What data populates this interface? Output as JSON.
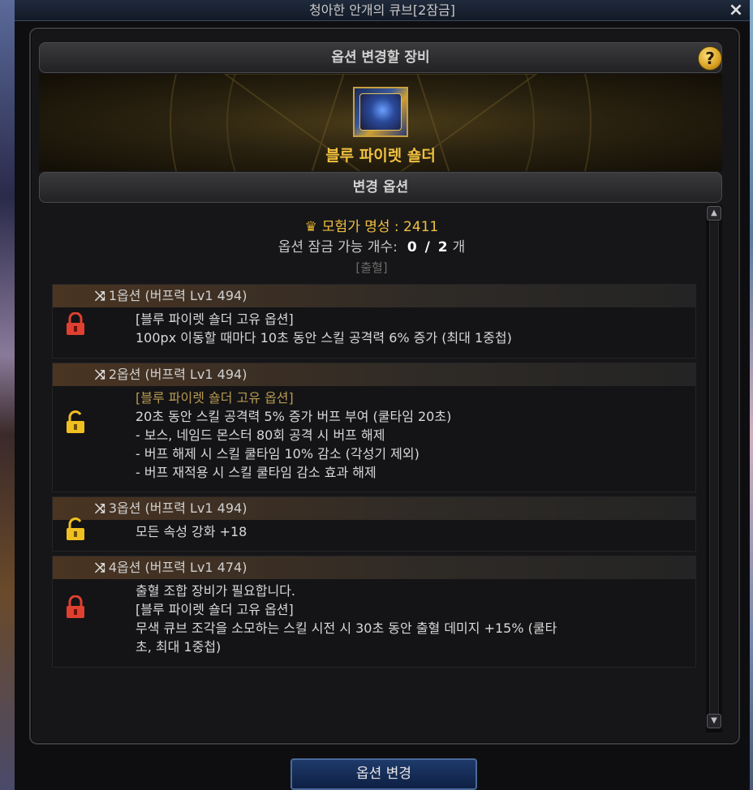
{
  "window": {
    "title": "청아한 안개의 큐브[2잠금]",
    "close_icon": "×"
  },
  "header_equipment": "옵션 변경할 장비",
  "help_icon": "?",
  "equipment": {
    "name": "블루 파이렛 숄더"
  },
  "header_options": "변경 옵션",
  "info": {
    "fame_label": "모험가 명성 : 2411",
    "lock_label": "옵션 잠금 가능 개수:",
    "lock_value": "0 / 2",
    "lock_unit": "개",
    "rarity": "[출혈]"
  },
  "options": [
    {
      "title": "1옵션 (버프력 Lv1 494)",
      "locked": true,
      "lines": [
        "[블루 파이렛 숄더 고유 옵션]",
        "100px 이동할 때마다 10초 동안 스킬 공격력 6% 증가 (최대 1중첩)"
      ]
    },
    {
      "title": "2옵션 (버프력 Lv1 494)",
      "locked": false,
      "lines": [
        "[블루 파이렛 숄더 고유 옵션]",
        "20초 동안 스킬 공격력 5% 증가 버프 부여 (쿨타임 20초)",
        "- 보스, 네임드 몬스터 80회 공격 시 버프 해제",
        "- 버프 해제 시 스킬 쿨타임 10% 감소 (각성기 제외)",
        "- 버프 재적용 시 스킬 쿨타임 감소 효과 해제"
      ]
    },
    {
      "title": "3옵션 (버프력 Lv1 494)",
      "locked": false,
      "lines": [
        "모든 속성 강화 +18"
      ]
    },
    {
      "title": "4옵션 (버프력 Lv1 474)",
      "locked": true,
      "lines": [
        "출혈 조합 장비가 필요합니다.",
        "[블루 파이렛 숄더 고유 옵션]",
        "무색 큐브 조각을 소모하는 스킬 시전 시 30초 동안 출혈 데미지 +15% (쿨타",
        "초, 최대 1중첩)"
      ]
    }
  ],
  "button_change": "옵션 변경",
  "colors": {
    "gold": "#f0c040",
    "lock_red": "#e04030",
    "lock_gold": "#f0c020",
    "button_blue": "#1e3a6a"
  }
}
